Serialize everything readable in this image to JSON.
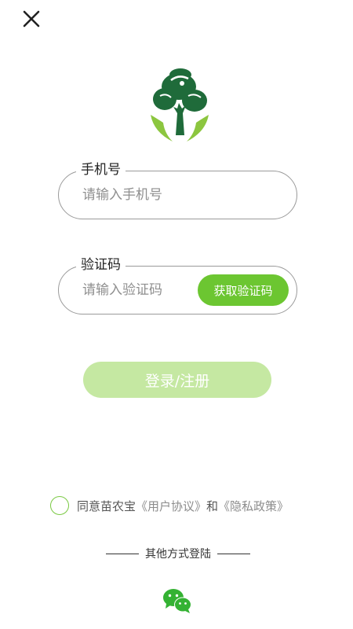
{
  "header": {
    "close_icon": "close-icon"
  },
  "logo": {
    "icon": "tree-in-hands-logo",
    "colors": {
      "tree": "#1f6b3a",
      "hands": "#8cc63f"
    }
  },
  "form": {
    "phone": {
      "label": "手机号",
      "placeholder": "请输入手机号",
      "value": ""
    },
    "code": {
      "label": "验证码",
      "placeholder": "请输入验证码",
      "value": "",
      "send_button_label": "获取验证码"
    },
    "login_button_label": "登录/注册"
  },
  "agreement": {
    "checked": false,
    "prefix": "同意苗农宝",
    "user_agreement": "《用户协议》",
    "conjunction": "和",
    "privacy_policy": "《隐私政策》"
  },
  "other_login": {
    "label": "其他方式登陆",
    "wechat_icon": "wechat-icon"
  },
  "colors": {
    "accent": "#6cc631",
    "login_button_disabled": "#c5e8a2",
    "field_border": "#9a9a9a",
    "wechat": "#34b233"
  }
}
